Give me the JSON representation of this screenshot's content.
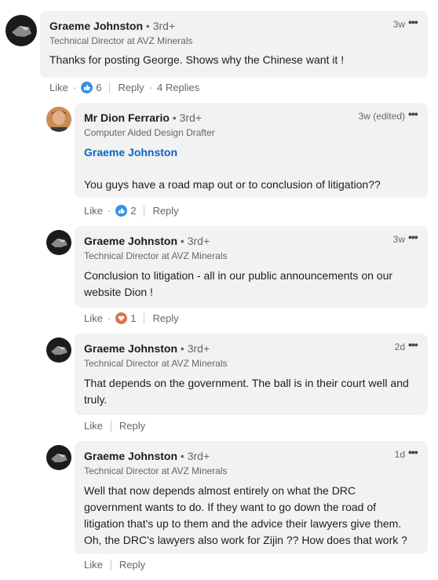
{
  "comments": [
    {
      "author": "Graeme Johnston",
      "degree": "• 3rd+",
      "headline": "Technical Director at AVZ Minerals",
      "time": "3w",
      "text": "Thanks for posting George. Shows why the Chinese want it !",
      "like": "Like",
      "reaction_count": "6",
      "reply": "Reply",
      "replies": "4 Replies"
    },
    {
      "author": "Mr Dion Ferrario",
      "degree": "• 3rd+",
      "headline": "Computer Aided Design Drafter",
      "time": "3w (edited)",
      "mention": "Graeme Johnston",
      "text": "You guys have a road map out or to conclusion of litigation??",
      "like": "Like",
      "reaction_count": "2",
      "reply": "Reply"
    },
    {
      "author": "Graeme Johnston",
      "degree": "• 3rd+",
      "headline": "Technical Director at AVZ Minerals",
      "time": "3w",
      "text_lines": [
        "Conclusion to litigation - all in our public announcements on our",
        "website Dion !"
      ],
      "like": "Like",
      "reaction_count": "1",
      "reply": "Reply"
    },
    {
      "author": "Graeme Johnston",
      "degree": "• 3rd+",
      "headline": "Technical Director at AVZ Minerals",
      "time": "2d",
      "text_lines": [
        "That depends on the government. The ball is in their court well and",
        "truly."
      ],
      "like": "Like",
      "reply": "Reply"
    },
    {
      "author": "Graeme Johnston",
      "degree": "• 3rd+",
      "headline": "Technical Director at AVZ Minerals",
      "time": "1d",
      "text_lines": [
        "Well that now depends almost entirely on what the DRC",
        "government wants to do. If they want to go down the road of",
        "litigation that's up to them and the advice their lawyers give them.",
        "Oh, the DRC's lawyers also work for Zijin ?? How does that work ?"
      ],
      "like": "Like",
      "reply": "Reply"
    }
  ],
  "colors": {
    "bubble": "#f2f2f2",
    "link": "#0a66c2",
    "like_icon": "#378fe9",
    "love_icon": "#df704d"
  },
  "icons": {
    "more": "more-icon",
    "like": "like-reaction-icon",
    "love": "love-reaction-icon"
  }
}
